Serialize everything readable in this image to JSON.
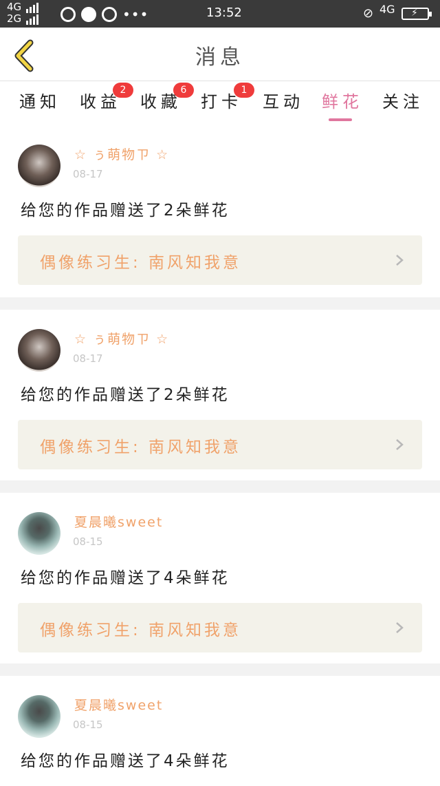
{
  "status_bar": {
    "net_top": "4G",
    "net_bottom": "2G",
    "time": "13:52",
    "signal_type": "4G",
    "icons": [
      "qq-icon",
      "chat-icon",
      "qq-icon",
      "more-dots-icon"
    ]
  },
  "header": {
    "title": "消息"
  },
  "tabs": [
    {
      "label": "通知",
      "badge": ""
    },
    {
      "label": "收益",
      "badge": "2"
    },
    {
      "label": "收藏",
      "badge": "6"
    },
    {
      "label": "打卡",
      "badge": "1"
    },
    {
      "label": "互动",
      "badge": ""
    },
    {
      "label": "鲜花",
      "badge": "",
      "active": true
    },
    {
      "label": "关注",
      "badge": ""
    }
  ],
  "messages": [
    {
      "user": "☆ ぅ萌物ㄗ ☆",
      "date": "08-17",
      "text": "给您的作品赠送了2朵鲜花",
      "work": "偶像练习生: 南风知我意"
    },
    {
      "user": "☆ ぅ萌物ㄗ ☆",
      "date": "08-17",
      "text": "给您的作品赠送了2朵鲜花",
      "work": "偶像练习生: 南风知我意"
    },
    {
      "user": "夏晨曦sweet",
      "date": "08-15",
      "text": "给您的作品赠送了4朵鲜花",
      "work": "偶像练习生: 南风知我意"
    },
    {
      "user": "夏晨曦sweet",
      "date": "08-15",
      "text": "给您的作品赠送了4朵鲜花"
    }
  ],
  "colors": {
    "accent_pink": "#e0769e",
    "username_orange": "#f0a26a",
    "badge_red": "#ef3b3b",
    "back_arrow_yellow": "#f2d544",
    "work_box_bg": "#f3f2ea"
  }
}
